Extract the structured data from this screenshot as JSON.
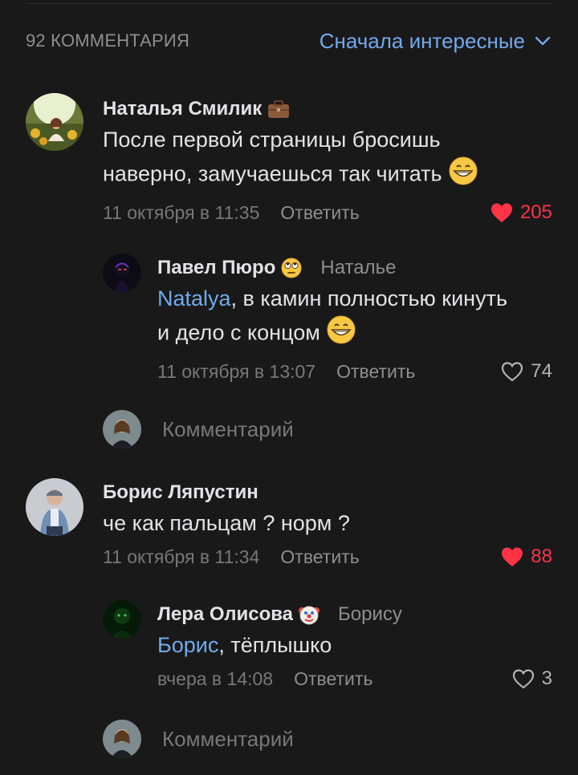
{
  "header": {
    "count": "92 КОММЕНТАРИЯ",
    "sort_label": "Сначала интересные"
  },
  "comments": [
    {
      "author": "Наталья Смилик",
      "text_lines": [
        "После первой страницы бросишь",
        "наверно, замучаешься так читать"
      ],
      "date": "11 октября в 11:35",
      "reply": "Ответить",
      "likes": "205",
      "liked": true
    },
    {
      "author": "Павел Пюро",
      "reply_to": "Наталье",
      "mention": "Natalya",
      "text_rest_line1": ", в камин полностью кинуть",
      "text_line2": "и дело с концом",
      "date": "11 октября в 13:07",
      "reply": "Ответить",
      "likes": "74",
      "liked": false
    },
    {
      "author": "Борис Ляпустин",
      "text": "че как пальцам ? норм ?",
      "date": "11 октября в 11:34",
      "reply": "Ответить",
      "likes": "88",
      "liked": true
    },
    {
      "author": "Лера Олисова",
      "reply_to": "Борису",
      "mention": "Борис",
      "text_rest": ", тёплышко",
      "date": "вчера в 14:08",
      "reply": "Ответить",
      "likes": "3",
      "liked": false
    }
  ],
  "comment_input": {
    "placeholder": "Комментарий"
  },
  "colors": {
    "background": "#19191a",
    "accent": "#71aaeb",
    "like": "#ff3347",
    "muted": "#76787a"
  },
  "icons": [
    "chevron-down-icon",
    "briefcase-icon",
    "grinning-emoji-icon",
    "rolling-eyes-emoji-icon",
    "clown-emoji-icon",
    "heart-icon"
  ]
}
